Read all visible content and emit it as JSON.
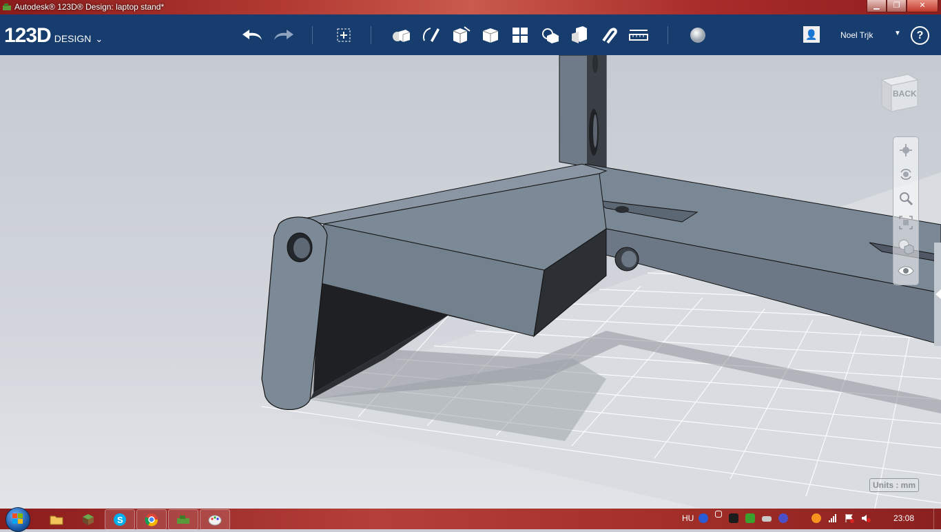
{
  "window": {
    "title": "Autodesk® 123D® Design: laptop stand*",
    "minimize_label": "▁",
    "restore_label": "❐",
    "close_label": "✕"
  },
  "app": {
    "logo_big": "123D",
    "logo_small": "DESIGN",
    "logo_menu_glyph": "⌄"
  },
  "toolbar": {
    "icons": [
      "undo-icon",
      "redo-icon",
      "transform-icon",
      "primitives-icon",
      "sketch-icon",
      "construct-icon",
      "modify-icon",
      "pattern-icon",
      "grouping-icon",
      "combine-icon",
      "snap-icon",
      "measure-icon",
      "material-icon"
    ]
  },
  "user": {
    "name": "Noel Trjk",
    "avatar_glyph": "👤",
    "menu_caret": "▼",
    "help_label": "?"
  },
  "viewcube": {
    "face_label": "BACK"
  },
  "navbar": {
    "items": [
      "pan-icon",
      "orbit-icon",
      "zoom-icon",
      "fit-icon",
      "visual-style-icon",
      "visibility-eye-icon"
    ]
  },
  "status": {
    "units_label": "Units : mm"
  },
  "taskbar": {
    "language": "HU",
    "clock": "23:08",
    "apps": [
      "explorer-icon",
      "minecraft-icon",
      "skype-icon",
      "chrome-icon",
      "123d-design-icon",
      "paint-icon"
    ]
  },
  "colors": {
    "toolbar_bg": "#173d6e",
    "model_face": "#6f7b88",
    "model_dark": "#23262a",
    "grid_line": "#ffffff"
  }
}
